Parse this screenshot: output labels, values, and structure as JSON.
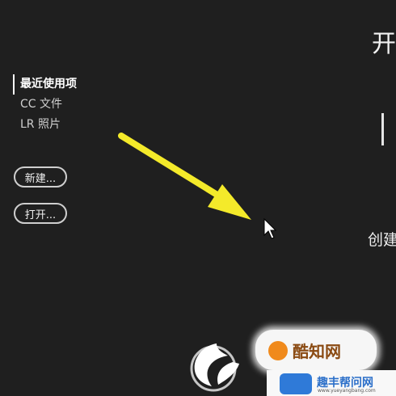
{
  "header": {
    "title": "开"
  },
  "sidebar": {
    "items": [
      {
        "label": "最近使用项",
        "active": true
      },
      {
        "label": "CC 文件",
        "active": false
      },
      {
        "label": "LR 照片",
        "active": false
      }
    ]
  },
  "actions": {
    "new_label": "新建...",
    "open_label": "打开..."
  },
  "main": {
    "create_label": "创建"
  },
  "watermarks": {
    "primary": "酷知网",
    "secondary": "趣丰帮问网",
    "secondary_url": "www.yueyangbang.com"
  },
  "colors": {
    "background": "#1f1f1f",
    "arrow": "#f4ea2a",
    "text": "#e6e6e6"
  }
}
